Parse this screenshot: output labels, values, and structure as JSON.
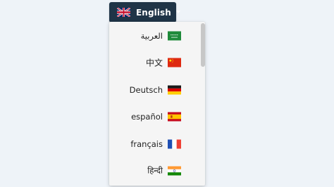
{
  "language_button": {
    "label": "English",
    "flag_icon": "uk-flag-icon",
    "background": "#1f3447"
  },
  "language_menu": {
    "items": [
      {
        "label": "العربية",
        "flag_icon": "saudi-arabia-flag-icon"
      },
      {
        "label": "中文",
        "flag_icon": "china-flag-icon"
      },
      {
        "label": "Deutsch",
        "flag_icon": "germany-flag-icon"
      },
      {
        "label": "español",
        "flag_icon": "spain-flag-icon"
      },
      {
        "label": "français",
        "flag_icon": "france-flag-icon"
      },
      {
        "label": "हिन्दी",
        "flag_icon": "india-flag-icon"
      }
    ]
  }
}
